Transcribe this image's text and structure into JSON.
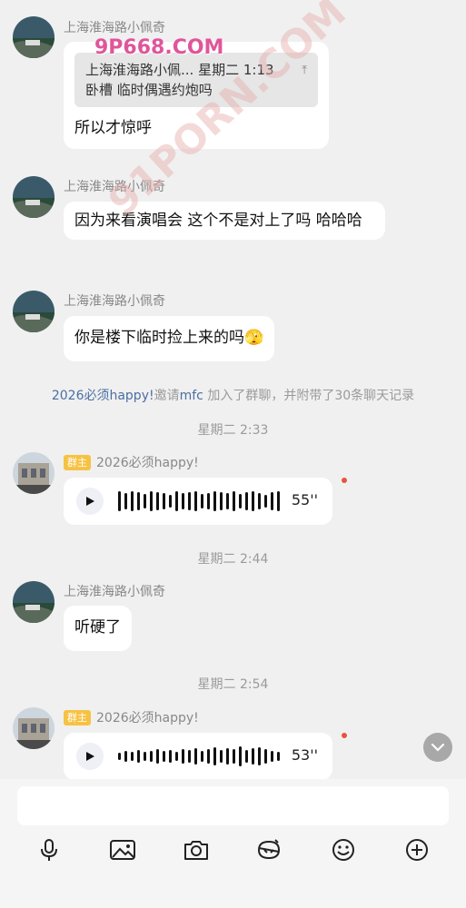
{
  "messages": [
    {
      "sender": "上海淮海路小佩奇",
      "quote": {
        "title": "上海淮海路小佩... 星期二 1:13",
        "text": "卧槽 临时偶遇约炮吗"
      },
      "text": "所以才惊呼"
    },
    {
      "sender": "上海淮海路小佩奇",
      "text": "因为来看演唱会 这个不是对上了吗 哈哈哈"
    },
    {
      "sender": "上海淮海路小佩奇",
      "text": "你是楼下临时捡上来的吗",
      "emoji": "🫣"
    },
    {
      "sender": "上海淮海路小佩奇",
      "text": "听硬了"
    }
  ],
  "system": {
    "invite_actor": "2026必须happy!",
    "invite_verb": "邀请",
    "invite_target": "mfc",
    "invite_rest": " 加入了群聊，并附带了30条聊天记录",
    "time1": "星期二 2:33",
    "time2": "星期二 2:44",
    "time3": "星期二 2:54"
  },
  "voices": [
    {
      "badge": "群主",
      "sender": "2026必须happy!",
      "duration": "55''",
      "unread": true
    },
    {
      "badge": "群主",
      "sender": "2026必须happy!",
      "duration": "53''",
      "unread": true
    }
  ],
  "watermarks": {
    "top": "9P668.COM",
    "diag": "91PORN.COM"
  },
  "composer": {
    "placeholder": ""
  },
  "toolbar": [
    "microphone-icon",
    "image-icon",
    "camera-icon",
    "red-packet-icon",
    "emoji-icon",
    "plus-icon"
  ],
  "colors": {
    "accent_link": "#4a6fa5",
    "owner_badge": "#f7c244",
    "unread_dot": "#e8533d"
  }
}
